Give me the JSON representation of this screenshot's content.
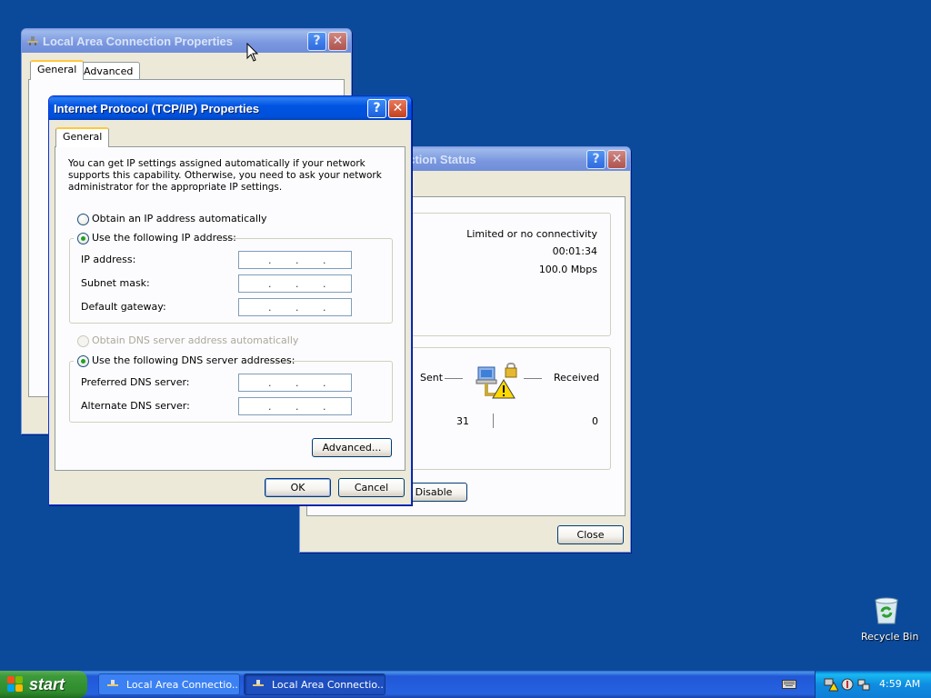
{
  "lac_window": {
    "title": "Local Area Connection Properties",
    "tabs": [
      "General",
      "Advanced"
    ]
  },
  "status_window": {
    "title_visible": "ection Status",
    "status": "Limited or no connectivity",
    "duration": "00:01:34",
    "speed": "100.0 Mbps",
    "sent_label": "Sent",
    "received_label": "Received",
    "sent_value": "31",
    "received_value": "0",
    "disable_label": "Disable",
    "close_label": "Close"
  },
  "tcpip_window": {
    "title": "Internet Protocol (TCP/IP) Properties",
    "tab": "General",
    "description": "You can get IP settings assigned automatically if your network supports this capability. Otherwise, you need to ask your network administrator for the appropriate IP settings.",
    "ip_auto": "Obtain an IP address automatically",
    "ip_manual": "Use the following IP address:",
    "ip_label": "IP address:",
    "subnet_label": "Subnet mask:",
    "gateway_label": "Default gateway:",
    "dns_auto": "Obtain DNS server address automatically",
    "dns_manual": "Use the following DNS server addresses:",
    "pref_dns_label": "Preferred DNS server:",
    "alt_dns_label": "Alternate DNS server:",
    "advanced_label": "Advanced...",
    "ok_label": "OK",
    "cancel_label": "Cancel",
    "ip_address_separator": ".   .   ."
  },
  "desktop": {
    "recycle_bin": "Recycle Bin"
  },
  "taskbar": {
    "start_label": "start",
    "tasks": [
      "Local Area Connectio...",
      "Local Area Connectio..."
    ],
    "clock": "4:59 AM"
  },
  "colors": {
    "desktop": "#0B4A9A",
    "titlebar_active": "#0054E3",
    "window_face": "#ECE9D8",
    "radio_dot": "#21A121",
    "taskbar": "#2663E0",
    "start": "#3C9A3A"
  }
}
